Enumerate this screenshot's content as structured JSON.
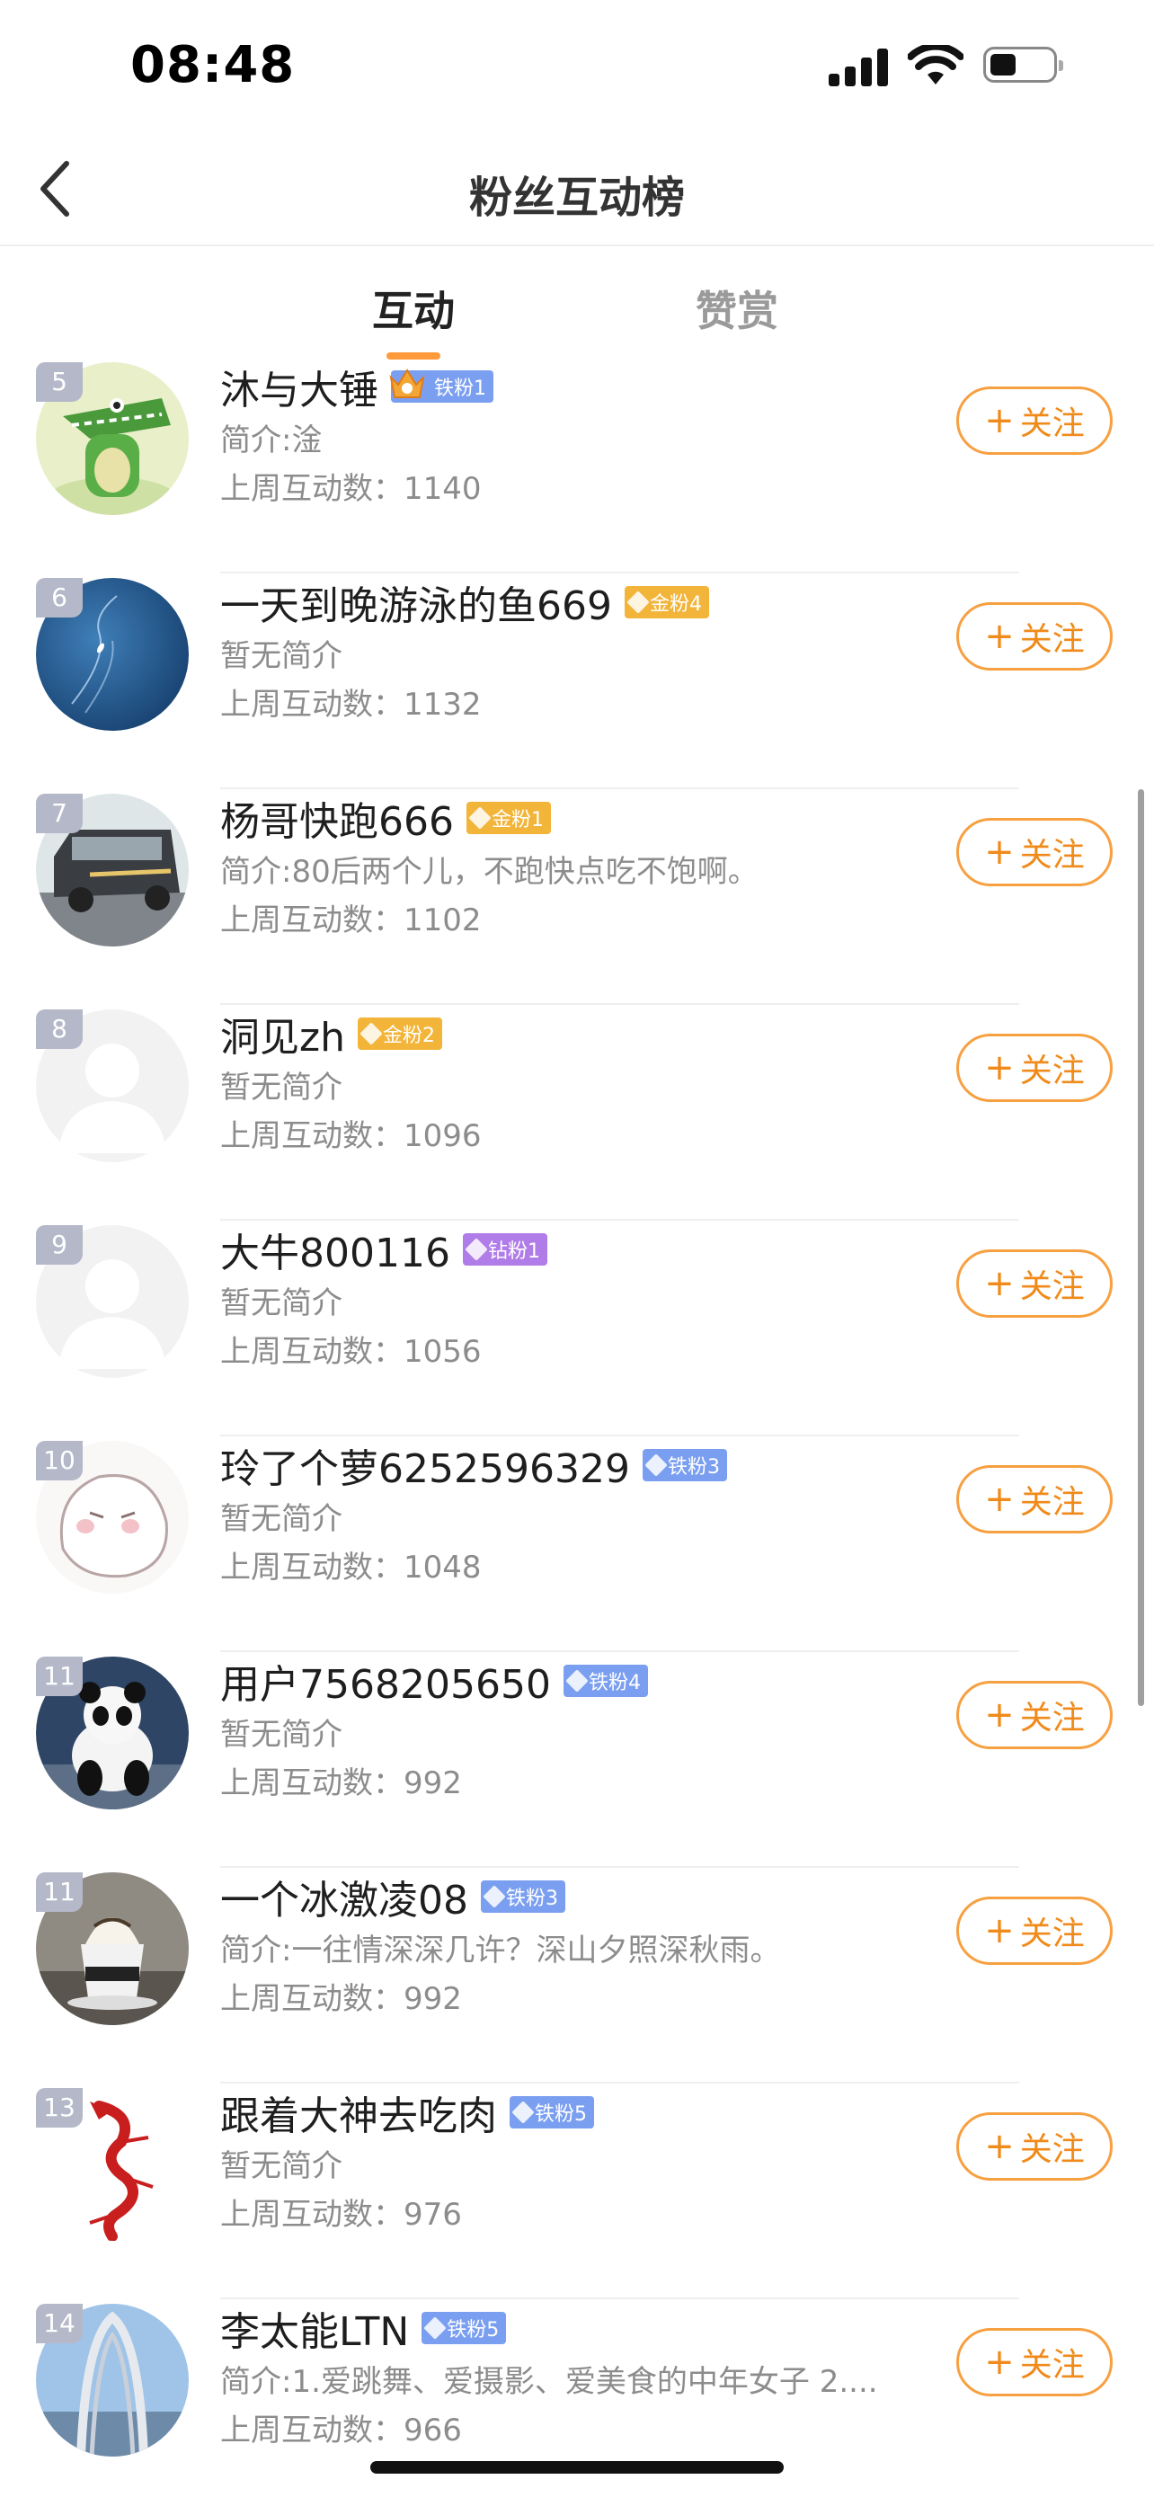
{
  "status": {
    "time": "08:48"
  },
  "header": {
    "title": "粉丝互动榜"
  },
  "tabs": [
    {
      "label": "互动",
      "active": true
    },
    {
      "label": "赞赏",
      "active": false
    }
  ],
  "list": [
    {
      "rank": "5",
      "name": "沐与大锤",
      "badge": "铁粉1",
      "badge_kind": "iron-crown",
      "bio": "简介:淦",
      "count": "上周互动数：1140",
      "follow": "关注",
      "avatar": "crocodile-avatar"
    },
    {
      "rank": "6",
      "name": "一天到晚游泳的鱼669",
      "badge": "金粉4",
      "badge_kind": "gold",
      "bio": "暂无简介",
      "count": "上周互动数：1132",
      "follow": "关注",
      "avatar": "ocean-avatar"
    },
    {
      "rank": "7",
      "name": "杨哥快跑666",
      "badge": "金粉1",
      "badge_kind": "gold",
      "bio": "简介:80后两个儿，不跑快点吃不饱啊。",
      "count": "上周互动数：1102",
      "follow": "关注",
      "avatar": "van-avatar"
    },
    {
      "rank": "8",
      "name": "洞见zh",
      "badge": "金粉2",
      "badge_kind": "gold",
      "bio": "暂无简介",
      "count": "上周互动数：1096",
      "follow": "关注",
      "avatar": "default-avatar"
    },
    {
      "rank": "9",
      "name": "大牛800116",
      "badge": "钻粉1",
      "badge_kind": "diamond",
      "bio": "暂无简介",
      "count": "上周互动数：1056",
      "follow": "关注",
      "avatar": "default-avatar"
    },
    {
      "rank": "10",
      "name": "玲了个萝6252596329",
      "badge": "铁粉3",
      "badge_kind": "iron",
      "bio": "暂无简介",
      "count": "上周互动数：1048",
      "follow": "关注",
      "avatar": "sketch-avatar"
    },
    {
      "rank": "11",
      "name": "用户7568205650",
      "badge": "铁粉4",
      "badge_kind": "iron",
      "bio": "暂无简介",
      "count": "上周互动数：992",
      "follow": "关注",
      "avatar": "panda-avatar"
    },
    {
      "rank": "11",
      "name": "一个冰激凌08",
      "badge": "铁粉3",
      "badge_kind": "iron",
      "bio": "简介:一往情深深几许？深山夕照深秋雨。",
      "count": "上周互动数：992",
      "follow": "关注",
      "avatar": "coffee-avatar"
    },
    {
      "rank": "13",
      "name": "跟着大神去吃肉",
      "badge": "铁粉5",
      "badge_kind": "iron",
      "bio": "暂无简介",
      "count": "上周互动数：976",
      "follow": "关注",
      "avatar": "dragon-avatar"
    },
    {
      "rank": "14",
      "name": "李太能LTN",
      "badge": "铁粉5",
      "badge_kind": "iron",
      "bio": "简介:1.爱跳舞、爱摄影、爱美食的中年女子 2....",
      "count": "上周互动数：966",
      "follow": "关注",
      "avatar": "bridge-avatar"
    }
  ],
  "colors": {
    "accent": "#f08a1a",
    "iron": "#7b9ff0",
    "gold": "#f2b53a",
    "diamond": "#b07ce8",
    "rank_bg": "#b5b8c8"
  }
}
